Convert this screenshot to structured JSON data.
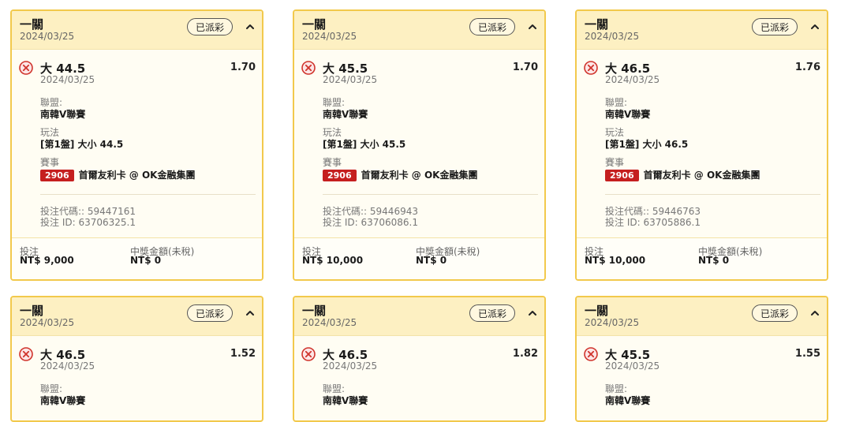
{
  "common": {
    "header_title": "一關",
    "header_date": "2024/03/25",
    "status_badge": "已派彩",
    "league_label": "聯盟:",
    "league_value": "南韓V聯賽",
    "play_label": "玩法",
    "event_label": "賽事",
    "event_code": "2906",
    "event_name": "首爾友利卡 @ OK金融集團",
    "stake_label": "投注",
    "payout_label": "中獎金額(未稅)",
    "payout_value": "NT$ 0",
    "status_icon": "lose-x-icon",
    "accent_color": "#f2c94c",
    "tag_color": "#c51f1f"
  },
  "cards": [
    {
      "selection": "大 44.5",
      "odds": "1.70",
      "date": "2024/03/25",
      "play_value": "[第1盤] 大小 44.5",
      "ticket_code": "投注代碼:: 59447161",
      "ticket_id": "投注 ID: 63706325.1",
      "stake": "NT$ 9,000"
    },
    {
      "selection": "大 45.5",
      "odds": "1.70",
      "date": "2024/03/25",
      "play_value": "[第1盤] 大小 45.5",
      "ticket_code": "投注代碼:: 59446943",
      "ticket_id": "投注 ID: 63706086.1",
      "stake": "NT$ 10,000"
    },
    {
      "selection": "大 46.5",
      "odds": "1.76",
      "date": "2024/03/25",
      "play_value": "[第1盤] 大小 46.5",
      "ticket_code": "投注代碼:: 59446763",
      "ticket_id": "投注 ID: 63705886.1",
      "stake": "NT$ 10,000"
    },
    {
      "selection": "大 46.5",
      "odds": "1.52",
      "date": "2024/03/25"
    },
    {
      "selection": "大 46.5",
      "odds": "1.82",
      "date": "2024/03/25"
    },
    {
      "selection": "大 45.5",
      "odds": "1.55",
      "date": "2024/03/25"
    }
  ]
}
